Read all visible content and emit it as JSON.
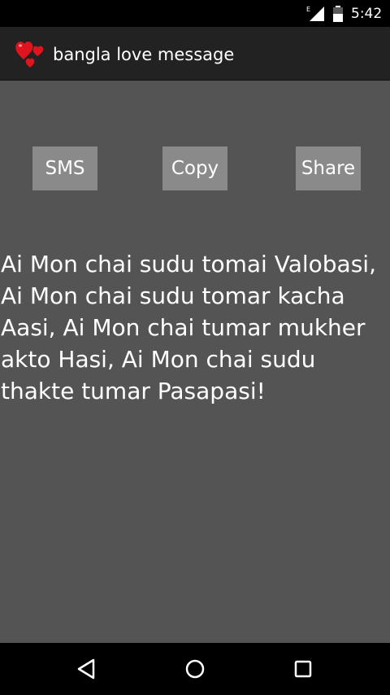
{
  "status_bar": {
    "network_type": "E",
    "time": "5:42"
  },
  "app_bar": {
    "title": "bangla love message",
    "logo_icon": "hearts-icon"
  },
  "actions": {
    "sms_label": "SMS",
    "copy_label": "Copy",
    "share_label": "Share"
  },
  "message": {
    "text": "Ai Mon chai sudu tomai Valobasi, Ai Mon chai sudu tomar kacha Aasi, Ai Mon chai tumar mukher akto Hasi, Ai Mon chai sudu thakte tumar Pasapasi!"
  },
  "nav_bar": {
    "back_icon": "back-triangle-icon",
    "home_icon": "home-circle-icon",
    "recents_icon": "recents-square-icon"
  },
  "colors": {
    "background": "#545454",
    "app_bar": "#222222",
    "button": "#8a8a8a",
    "text": "#ffffff",
    "heart": "#e0141e"
  }
}
